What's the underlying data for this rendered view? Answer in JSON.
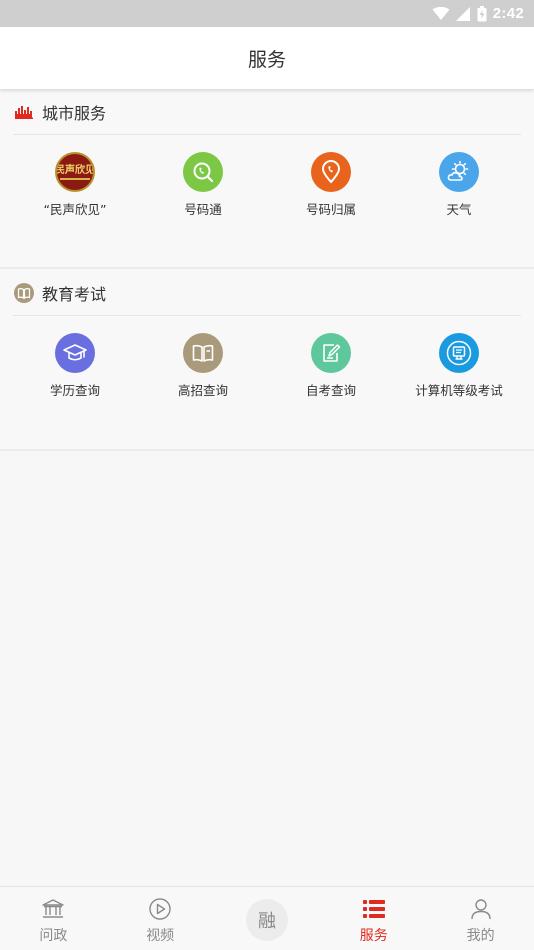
{
  "status_bar": {
    "time": "2:42"
  },
  "header": {
    "title": "服务"
  },
  "sections": [
    {
      "title": "城市服务",
      "icon": "city-skyline-icon",
      "items": [
        {
          "label": "“民声欣见”",
          "icon": "minsheng-logo",
          "logo_text": "民声欣见",
          "color": "#8a1a12"
        },
        {
          "label": "号码通",
          "icon": "phone-search-icon",
          "color": "#7cc845"
        },
        {
          "label": "号码归属",
          "icon": "location-phone-icon",
          "color": "#e8641d"
        },
        {
          "label": "天气",
          "icon": "weather-icon",
          "color": "#4aa5ea"
        }
      ]
    },
    {
      "title": "教育考试",
      "icon": "book-icon",
      "items": [
        {
          "label": "学历查询",
          "icon": "graduation-cap-icon",
          "color": "#6a6fe0"
        },
        {
          "label": "高招查询",
          "icon": "open-book-icon",
          "color": "#a99a7c"
        },
        {
          "label": "自考查询",
          "icon": "edit-note-icon",
          "color": "#5fc79c"
        },
        {
          "label": "计算机等级考试",
          "icon": "computer-icon",
          "color": "#1a9be0"
        }
      ]
    }
  ],
  "tab_bar": {
    "tabs": [
      {
        "label": "问政",
        "icon": "government-building-icon",
        "active": false
      },
      {
        "label": "视频",
        "icon": "play-circle-icon",
        "active": false
      },
      {
        "label": "融",
        "icon": "rong-center-icon",
        "active": false
      },
      {
        "label": "服务",
        "icon": "service-list-icon",
        "active": true
      },
      {
        "label": "我的",
        "icon": "user-icon",
        "active": false
      }
    ]
  },
  "colors": {
    "accent": "#e02a1f",
    "inactive": "#8a8a8a"
  }
}
